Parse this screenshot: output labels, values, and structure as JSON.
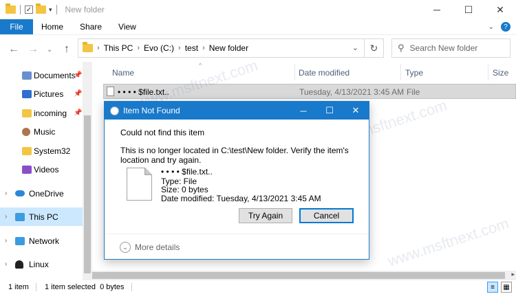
{
  "window": {
    "title": "New folder",
    "controls": {
      "minimize": "─",
      "maximize": "☐",
      "close": "✕"
    }
  },
  "ribbon": {
    "file_label": "File",
    "tabs": [
      "Home",
      "Share",
      "View"
    ]
  },
  "address": {
    "crumbs": [
      "This PC",
      "Evo (C:)",
      "test",
      "New folder"
    ]
  },
  "search": {
    "placeholder": "Search New folder"
  },
  "sidebar": {
    "items": [
      {
        "label": "Documents",
        "icon": "documents-icon",
        "pinned": true,
        "color": "#6a8fd0"
      },
      {
        "label": "Pictures",
        "icon": "pictures-icon",
        "pinned": true,
        "color": "#2f6fce"
      },
      {
        "label": "incoming",
        "icon": "folder-icon",
        "pinned": true,
        "color": "#f4c542"
      },
      {
        "label": "Music",
        "icon": "music-icon",
        "pinned": false,
        "color": "#b0734d"
      },
      {
        "label": "System32",
        "icon": "folder-icon",
        "pinned": false,
        "color": "#f4c542"
      },
      {
        "label": "Videos",
        "icon": "videos-icon",
        "pinned": false,
        "color": "#8a4fc8"
      },
      {
        "label": "OneDrive",
        "icon": "onedrive-icon",
        "pinned": false,
        "color": "#2b88d8"
      },
      {
        "label": "This PC",
        "icon": "computer-icon",
        "pinned": false,
        "color": "#3d9be0",
        "selected": true
      },
      {
        "label": "Network",
        "icon": "network-icon",
        "pinned": false,
        "color": "#3d9be0"
      },
      {
        "label": "Linux",
        "icon": "linux-icon",
        "pinned": false,
        "color": "#222222"
      }
    ]
  },
  "filelist": {
    "columns": [
      "Name",
      "Date modified",
      "Type",
      "Size"
    ],
    "rows": [
      {
        "name": "• • • • $file.txt..",
        "date": "Tuesday, 4/13/2021 3:45 AM",
        "type": "File"
      }
    ]
  },
  "status": {
    "count": "1 item",
    "selection": "1 item selected  0 bytes"
  },
  "dialog": {
    "title": "Item Not Found",
    "heading": "Could not find this item",
    "message": "This is no longer located in C:\\test\\New folder. Verify the item's location and try again.",
    "file_name": "• • • • $file.txt..",
    "file_type": "Type: File",
    "file_size": "Size: 0 bytes",
    "file_date": "Date modified: Tuesday, 4/13/2021 3:45 AM",
    "try_again": "Try Again",
    "cancel": "Cancel",
    "more_details": "More details"
  },
  "watermark": "www.msftnext.com",
  "colors": {
    "accent": "#1979ca",
    "selection": "#cce8ff"
  }
}
